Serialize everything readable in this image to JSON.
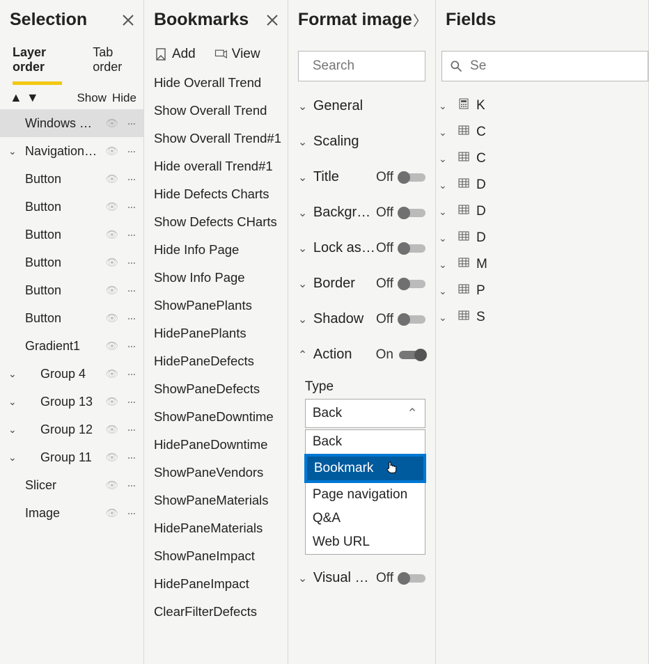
{
  "selection": {
    "title": "Selection",
    "tabs": {
      "layer": "Layer order",
      "tab": "Tab order"
    },
    "showHide": {
      "show": "Show",
      "hide": "Hide"
    },
    "items": [
      {
        "label": "Windows Button",
        "chevron": "",
        "selected": true
      },
      {
        "label": "Navigation Panel",
        "chevron": "v"
      },
      {
        "label": "Button",
        "chevron": ""
      },
      {
        "label": "Button",
        "chevron": ""
      },
      {
        "label": "Button",
        "chevron": ""
      },
      {
        "label": "Button",
        "chevron": ""
      },
      {
        "label": "Button",
        "chevron": ""
      },
      {
        "label": "Button",
        "chevron": ""
      },
      {
        "label": "Gradient1",
        "chevron": ""
      },
      {
        "label": "Group 4",
        "chevron": "v",
        "indent": true
      },
      {
        "label": "Group 13",
        "chevron": "v",
        "indent": true
      },
      {
        "label": "Group 12",
        "chevron": "v",
        "indent": true
      },
      {
        "label": "Group 11",
        "chevron": "v",
        "indent": true
      },
      {
        "label": "Slicer",
        "chevron": ""
      },
      {
        "label": "Image",
        "chevron": ""
      }
    ]
  },
  "bookmarks": {
    "title": "Bookmarks",
    "add": "Add",
    "view": "View",
    "items": [
      "Hide Overall Trend",
      "Show Overall Trend",
      "Show Overall Trend#1",
      "Hide overall Trend#1",
      "Hide Defects Charts",
      "Show Defects CHarts",
      "Hide Info Page",
      "Show Info Page",
      "ShowPanePlants",
      "HidePanePlants",
      "HidePaneDefects",
      "ShowPaneDefects",
      "ShowPaneDowntime",
      "HidePaneDowntime",
      "ShowPaneVendors",
      "ShowPaneMaterials",
      "HidePaneMaterials",
      "ShowPaneImpact",
      "HidePaneImpact",
      "ClearFilterDefects"
    ]
  },
  "format": {
    "title": "Format image",
    "searchPlaceholder": "Search",
    "rows": {
      "general": {
        "label": "General",
        "toggle": null,
        "expanded": false
      },
      "scaling": {
        "label": "Scaling",
        "toggle": null,
        "expanded": false
      },
      "title": {
        "label": "Title",
        "toggle": "Off",
        "expanded": false
      },
      "background": {
        "label": "Backgrou...",
        "toggle": "Off",
        "expanded": false
      },
      "lockAspect": {
        "label": "Lock aspe...",
        "toggle": "Off",
        "expanded": false
      },
      "border": {
        "label": "Border",
        "toggle": "Off",
        "expanded": false
      },
      "shadow": {
        "label": "Shadow",
        "toggle": "Off",
        "expanded": false
      },
      "action": {
        "label": "Action",
        "toggle": "On",
        "expanded": true
      },
      "visualHeader": {
        "label": "Visual he...",
        "toggle": "Off",
        "expanded": false
      }
    },
    "action": {
      "typeLabel": "Type",
      "selected": "Back",
      "options": [
        "Back",
        "Bookmark",
        "Page navigation",
        "Q&A",
        "Web URL"
      ],
      "highlighted": "Bookmark"
    }
  },
  "fields": {
    "title": "Fields",
    "searchPlaceholder": "Se",
    "items": [
      {
        "icon": "calc",
        "label": "K"
      },
      {
        "icon": "table",
        "label": "C"
      },
      {
        "icon": "table",
        "label": "C"
      },
      {
        "icon": "table",
        "label": "D"
      },
      {
        "icon": "table",
        "label": "D"
      },
      {
        "icon": "table",
        "label": "D"
      },
      {
        "icon": "table",
        "label": "M"
      },
      {
        "icon": "table",
        "label": "P"
      },
      {
        "icon": "table",
        "label": "S"
      }
    ]
  }
}
